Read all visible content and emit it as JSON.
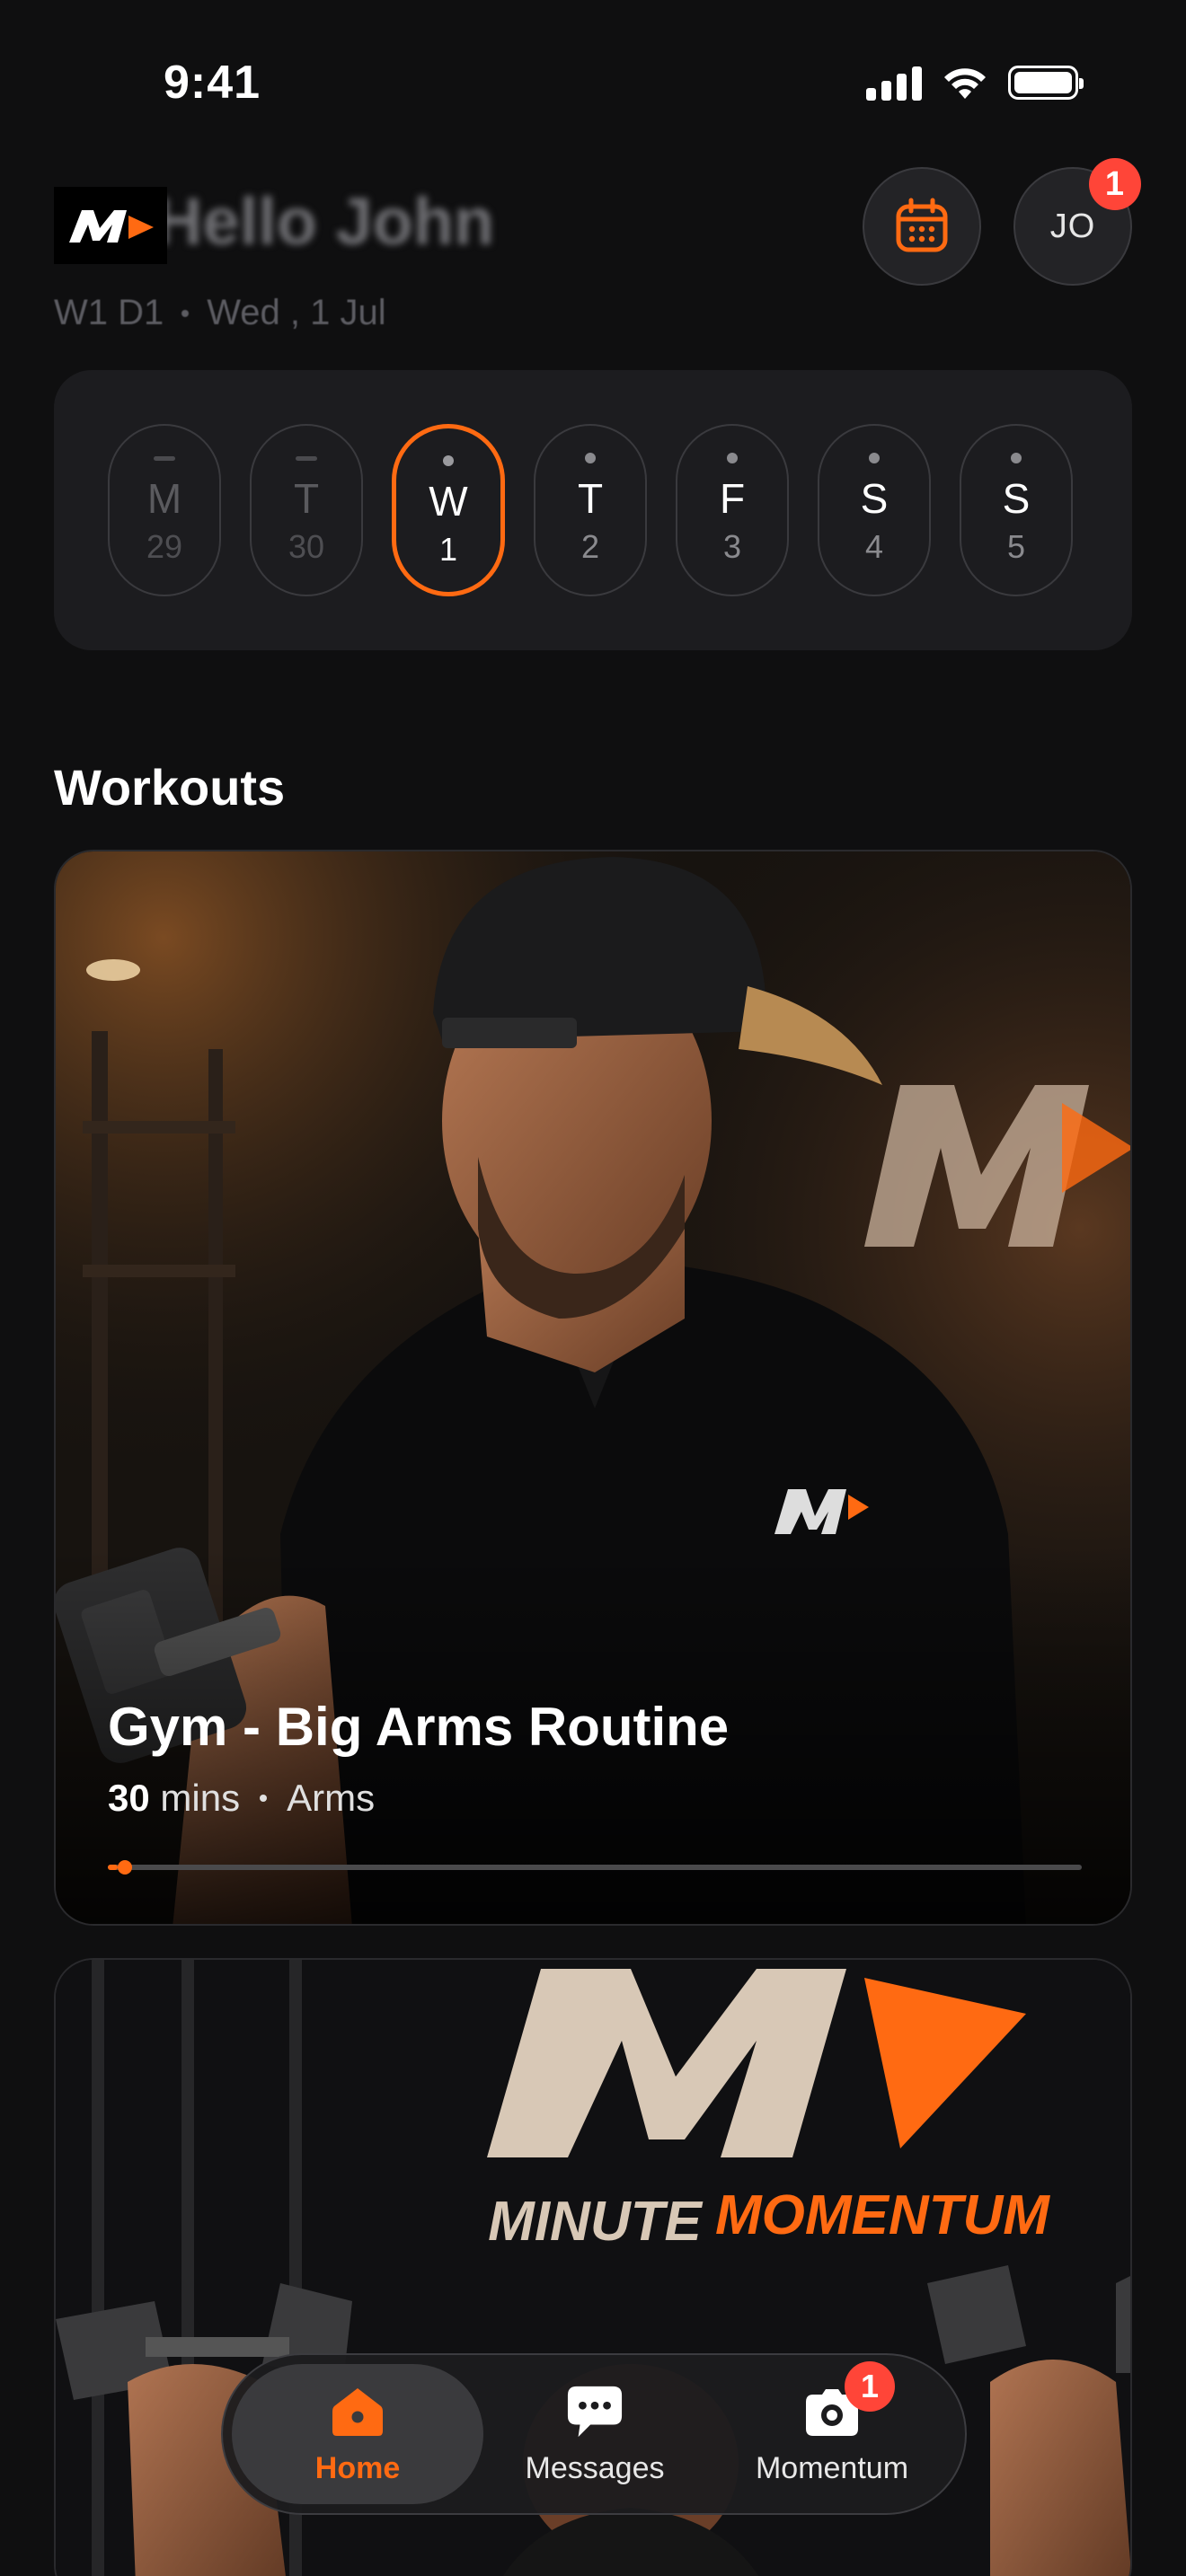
{
  "status_bar": {
    "time": "9:41"
  },
  "header": {
    "greeting": "Hello John",
    "plan_code": "W1 D1",
    "date": "Wed , 1 Jul",
    "avatar_initials": "JO",
    "avatar_badge": "1"
  },
  "week": {
    "days": [
      {
        "letter": "M",
        "num": "29"
      },
      {
        "letter": "T",
        "num": "30"
      },
      {
        "letter": "W",
        "num": "1"
      },
      {
        "letter": "T",
        "num": "2"
      },
      {
        "letter": "F",
        "num": "3"
      },
      {
        "letter": "S",
        "num": "4"
      },
      {
        "letter": "S",
        "num": "5"
      }
    ],
    "selected_index": 2
  },
  "workouts": {
    "title": "Workouts",
    "cards": [
      {
        "title": "Gym - Big Arms Routine",
        "duration_value": "30",
        "duration_unit": "mins",
        "category": "Arms",
        "progress": 0.01
      }
    ]
  },
  "bottom_nav": {
    "items": [
      {
        "label": "Home",
        "icon": "home-icon",
        "active": true
      },
      {
        "label": "Messages",
        "icon": "chat-bubble-icon"
      },
      {
        "label": "Momentum",
        "icon": "camera-icon",
        "badge": "1"
      }
    ]
  },
  "brand": {
    "accent": "#ff6a12",
    "badge": "#ff4538",
    "background": "#0f0f10",
    "logo_text_primary": "MINUTE",
    "logo_text_secondary": "MOMENTUM"
  }
}
